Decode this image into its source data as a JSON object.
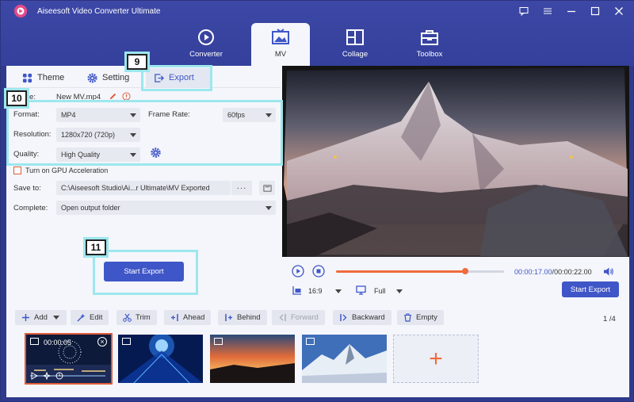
{
  "app": {
    "title": "Aiseesoft Video Converter Ultimate"
  },
  "nav": {
    "tabs": [
      {
        "label": "Converter",
        "icon": "converter-icon"
      },
      {
        "label": "MV",
        "icon": "mv-icon",
        "active": true
      },
      {
        "label": "Collage",
        "icon": "collage-icon"
      },
      {
        "label": "Toolbox",
        "icon": "toolbox-icon"
      }
    ]
  },
  "subtabs": {
    "theme": "Theme",
    "setting": "Setting",
    "export": "Export"
  },
  "export": {
    "name_label": "Name:",
    "name_value": "New MV.mp4",
    "format_label": "Format:",
    "format_value": "MP4",
    "frame_rate_label": "Frame Rate:",
    "frame_rate_value": "60fps",
    "resolution_label": "Resolution:",
    "resolution_value": "1280x720 (720p)",
    "quality_label": "Quality:",
    "quality_value": "High Quality",
    "gpu_label": "Turn on GPU Acceleration",
    "save_to_label": "Save to:",
    "save_to_value": "C:\\Aiseesoft Studio\\Ai...r Ultimate\\MV Exported",
    "dots": "···",
    "complete_label": "Complete:",
    "complete_value": "Open output folder",
    "start_export": "Start Export"
  },
  "callouts": {
    "c9": "9",
    "c10": "10",
    "c11": "11"
  },
  "player": {
    "current_time": "00:00:17.00",
    "separator": "/",
    "total_time": "00:00:22.00",
    "progress": 0.77,
    "ratio": "16:9",
    "zoom": "Full",
    "start_export": "Start Export"
  },
  "toolbar": {
    "add": "Add",
    "edit": "Edit",
    "trim": "Trim",
    "ahead": "Ahead",
    "behind": "Behind",
    "forward": "Forward",
    "backward": "Backward",
    "empty": "Empty",
    "page": "1 /4"
  },
  "timeline": {
    "first_clip_time": "00:00:05",
    "add_symbol": "+"
  },
  "colors": {
    "accent": "#3f56c8",
    "orange": "#f06b3e",
    "header": "#34409b",
    "callout": "#9de7ee"
  }
}
